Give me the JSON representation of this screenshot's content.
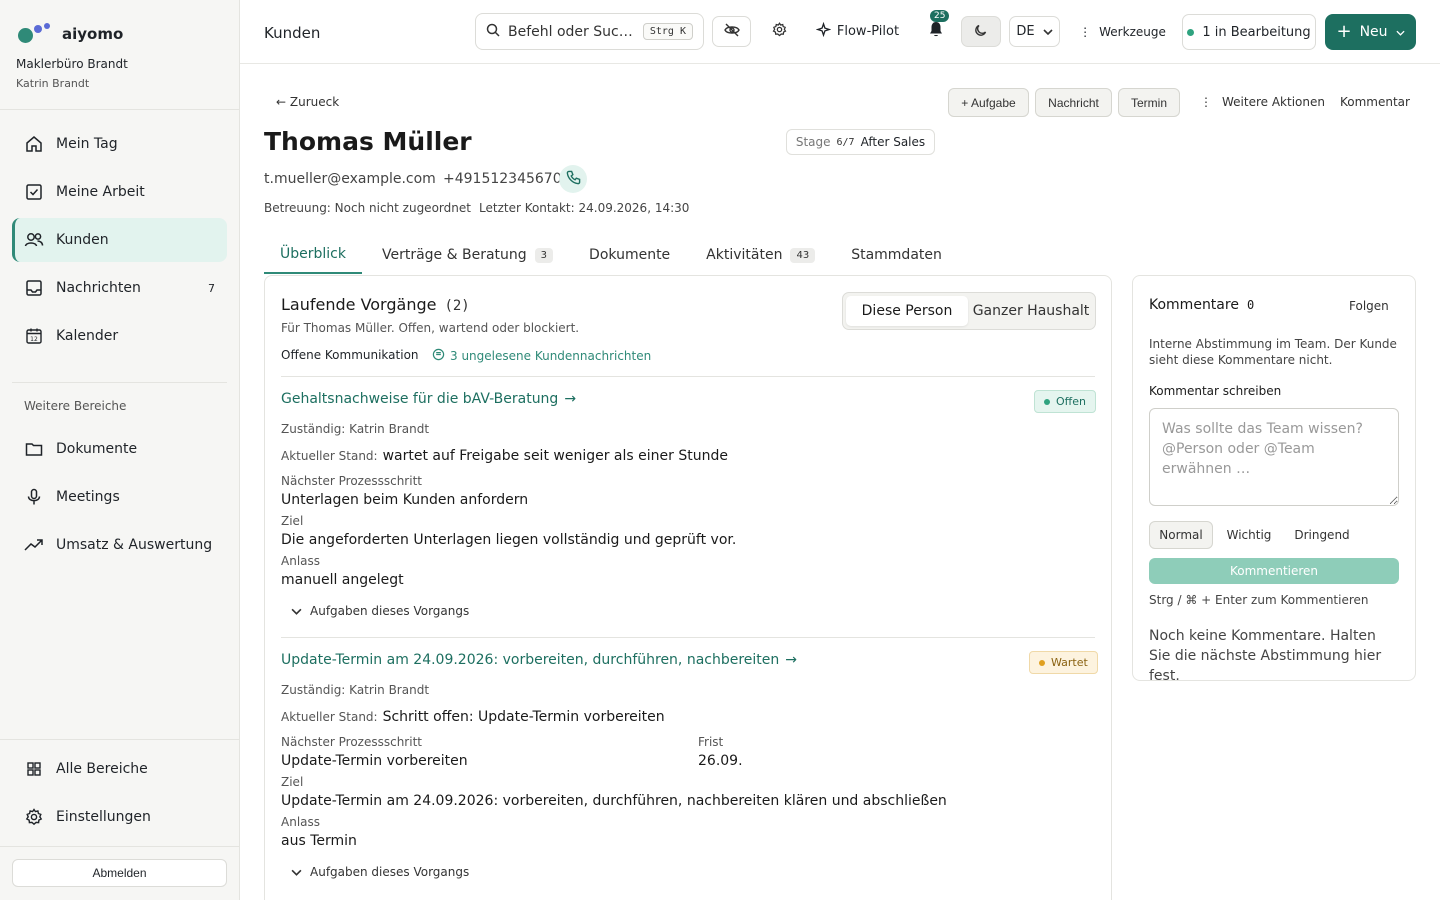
{
  "colors": {
    "accent": "#1d6f60",
    "accent_light": "#e2f3ee",
    "warning": "#e0a020",
    "open": "#2fa37f"
  },
  "sidebar": {
    "brand_name": "aiyomo",
    "org_name": "Maklerbüro Brandt",
    "user_name": "Katrin Brandt",
    "items": [
      {
        "label": "Mein Tag",
        "icon": "home-icon"
      },
      {
        "label": "Meine Arbeit",
        "icon": "checkbox-icon"
      },
      {
        "label": "Kunden",
        "icon": "users-icon",
        "active": true
      },
      {
        "label": "Nachrichten",
        "icon": "inbox-icon",
        "badge": "7"
      },
      {
        "label": "Kalender",
        "icon": "calendar-icon",
        "icon_text": "12"
      }
    ],
    "section_label": "Weitere Bereiche",
    "more_items": [
      {
        "label": "Dokumente",
        "icon": "folder-icon"
      },
      {
        "label": "Meetings",
        "icon": "microphone-icon"
      },
      {
        "label": "Umsatz & Auswertung",
        "icon": "trend-icon"
      }
    ],
    "bottom_items": [
      {
        "label": "Alle Bereiche",
        "icon": "grid-icon"
      },
      {
        "label": "Einstellungen",
        "icon": "gear-icon"
      }
    ],
    "logout_label": "Abmelden"
  },
  "topbar": {
    "title": "Kunden",
    "search_text": "Befehl oder Suc…",
    "search_kbd": "Strg K",
    "flow_pilot": "Flow-Pilot",
    "bell_count": "25",
    "lang": "DE",
    "tools": "Werkzeuge",
    "in_progress": "1 in Bearbeitung",
    "new_label": "Neu"
  },
  "header": {
    "back": "← Zurueck",
    "actions": {
      "task": "+ Aufgabe",
      "message": "Nachricht",
      "appointment": "Termin",
      "more": "Weitere Aktionen",
      "comment": "Kommentar"
    },
    "name": "Thomas Müller",
    "stage_label": "Stage",
    "stage_value": "6/7",
    "stage_name": "After Sales",
    "email": "t.mueller@example.com",
    "phone": "+4915123456701",
    "care": "Betreuung: Noch nicht zugeordnet",
    "last_contact": "Letzter Kontakt: 24.09.2026, 14:30"
  },
  "tabs": [
    {
      "label": "Überblick",
      "active": true
    },
    {
      "label": "Verträge & Beratung",
      "count": "3"
    },
    {
      "label": "Dokumente"
    },
    {
      "label": "Aktivitäten",
      "count": "43"
    },
    {
      "label": "Stammdaten"
    }
  ],
  "processes": {
    "title": "Laufende Vorgänge",
    "count": "(2)",
    "subtitle": "Für Thomas Müller. Offen, wartend oder blockiert.",
    "toggle": {
      "person": "Diese Person",
      "household": "Ganzer Haushalt"
    },
    "open_comm_label": "Offene Kommunikation",
    "unread": "3 ungelesene Kundennachrichten",
    "labels": {
      "status_current": "Aktueller Stand:",
      "next_step": "Nächster Prozessschritt",
      "goal": "Ziel",
      "reason": "Anlass",
      "deadline": "Frist",
      "tasks": "Aufgaben dieses Vorgangs"
    },
    "items": [
      {
        "title": "Gehaltsnachweise für die bAV-Beratung",
        "status": "Offen",
        "owner": "Zuständig: Katrin Brandt",
        "current": "wartet auf Freigabe seit weniger als einer Stunde",
        "next_step": "Unterlagen beim Kunden anfordern",
        "goal": "Die angeforderten Unterlagen liegen vollständig und geprüft vor.",
        "reason": "manuell angelegt"
      },
      {
        "title": "Update-Termin am 24.09.2026: vorbereiten, durchführen, nachbereiten",
        "status": "Wartet",
        "owner": "Zuständig: Katrin Brandt",
        "current": "Schritt offen: Update-Termin vorbereiten",
        "next_step": "Update-Termin vorbereiten",
        "deadline": "26.09.",
        "goal": "Update-Termin am 24.09.2026: vorbereiten, durchführen, nachbereiten klären und abschließen",
        "reason": "aus Termin"
      }
    ]
  },
  "comments": {
    "title": "Kommentare",
    "count": "0",
    "follow": "Folgen",
    "description": "Interne Abstimmung im Team. Der Kunde sieht diese Kommentare nicht.",
    "write_label": "Kommentar schreiben",
    "placeholder": "Was sollte das Team wissen? @Person oder @Team erwähnen …",
    "priorities": [
      "Normal",
      "Wichtig",
      "Dringend"
    ],
    "submit": "Kommentieren",
    "hint": "Strg / ⌘ + Enter zum Kommentieren",
    "empty": "Noch keine Kommentare. Halten Sie die nächste Abstimmung hier fest."
  }
}
